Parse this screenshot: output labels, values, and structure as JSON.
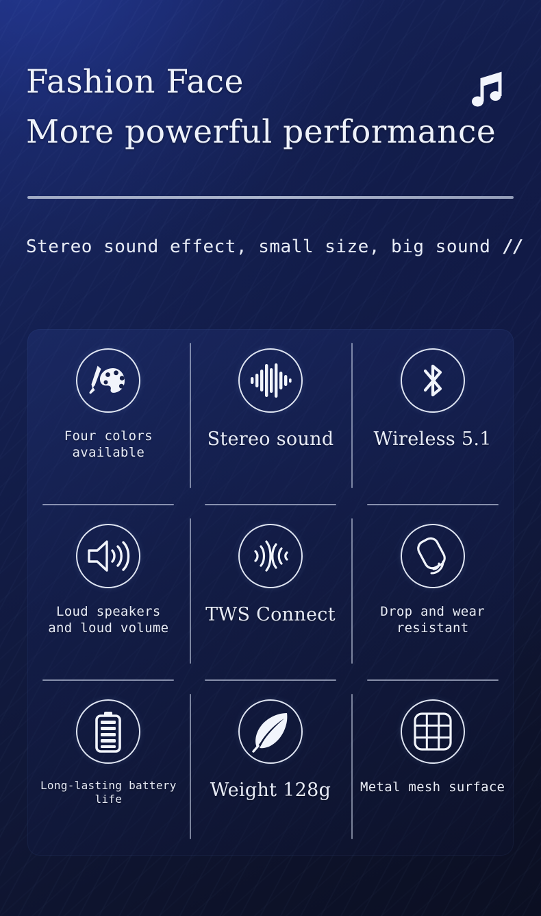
{
  "header": {
    "title_main": "Fashion Face",
    "title_sub": "More powerful performance",
    "music_icon": "music-note-icon",
    "tagline": "Stereo sound effect, small size, big sound",
    "tagline_mark": "//"
  },
  "colors": {
    "background_top_left": "#1a2a72",
    "background_bottom_right": "#0b0f22",
    "text": "#e9edf7",
    "rule": "#c6cfe2",
    "icon_stroke": "#dfe5f2"
  },
  "features": [
    {
      "icon": "color-palette-icon",
      "label": "Four colors available",
      "size": "sz-md"
    },
    {
      "icon": "sound-waveform-icon",
      "label": "Stereo sound",
      "size": "sz-lg"
    },
    {
      "icon": "bluetooth-icon",
      "label": "Wireless 5.1",
      "size": "sz-lg"
    },
    {
      "icon": "loud-speaker-icon",
      "label": "Loud speakers\nand loud volume",
      "size": "sz-md"
    },
    {
      "icon": "tws-connect-icon",
      "label": "TWS Connect",
      "size": "sz-lg"
    },
    {
      "icon": "drop-resistant-icon",
      "label": "Drop and wear resistant",
      "size": "sz-md"
    },
    {
      "icon": "battery-icon",
      "label": "Long-lasting battery life",
      "size": "sz-sm"
    },
    {
      "icon": "feather-icon",
      "label": "Weight 128g",
      "size": "sz-lg"
    },
    {
      "icon": "metal-mesh-icon",
      "label": "Metal mesh surface",
      "size": "sz-md"
    }
  ]
}
